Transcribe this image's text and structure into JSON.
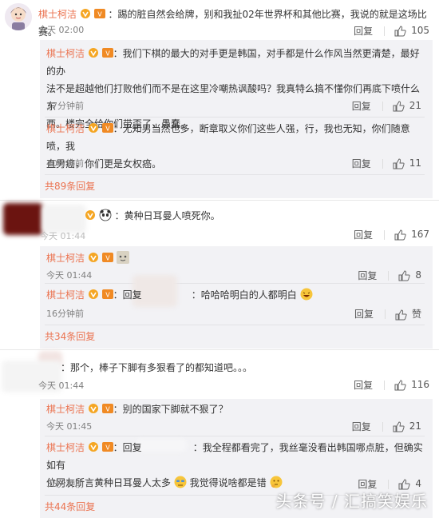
{
  "comments": [
    {
      "user": "棋士柯洁",
      "text": "：踢的脏自然会给牌，别和我扯02年世界杯和其他比赛，我说的就是这场比赛。",
      "time": "今天 02:00",
      "reply_label": "回复",
      "likes": "105",
      "replies": [
        {
          "user": "棋士柯洁",
          "text_1": "：我们下棋的最大的对手更是韩国，对手都是什么作风当然更清楚，最好的办",
          "text_2": "法不是超越他们打败他们而不是在这里冷嘲热讽酸吗？我真特么搞不懂你们再底下喷什么东",
          "text_3": "西。楼完全给你们带歪了，愚蠢。",
          "time": "37分钟前",
          "reply_label": "回复",
          "likes": "21"
        },
        {
          "user": "棋士柯洁",
          "text_1": "：无知男当然也多，断章取义你们这些人强，行，我也无知，你们随意喷，我",
          "text_2": "直男癌，你们更是女权癌。",
          "time": "40分钟前",
          "reply_label": "回复",
          "likes": "11"
        }
      ],
      "more": "共89条回复"
    },
    {
      "text": "：黄种日耳曼人喷死你。",
      "time": "今天 01:44",
      "reply_label": "回复",
      "likes": "167",
      "replies": [
        {
          "user": "棋士柯洁",
          "time": "今天 01:44",
          "reply_label": "回复",
          "likes": "8"
        },
        {
          "user": "棋士柯洁",
          "text_1": "：回复",
          "text_2": "：哈哈哈明白的人都明白",
          "time": "16分钟前",
          "reply_label": "回复",
          "likes": "赞"
        }
      ],
      "more": "共34条回复"
    },
    {
      "text": "：那个，棒子下脚有多狠看了的都知道吧。。。",
      "time": "今天 01:44",
      "reply_label": "回复",
      "likes": "116",
      "replies": [
        {
          "user": "棋士柯洁",
          "text_1": "：别的国家下脚就不狠了？",
          "time": "今天 01:45",
          "reply_label": "回复",
          "likes": "21"
        },
        {
          "user": "棋士柯洁",
          "text_1": "：回复",
          "text_2": "：我全程都看完了，我丝毫没看出韩国哪点脏，但确实如有",
          "text_3": "位网友所言黄种日耳曼人太多",
          "text_4": "我觉得说啥都是错",
          "time": "35分钟前",
          "reply_label": "回复",
          "likes": "4"
        }
      ],
      "more": "共44条回复"
    }
  ],
  "watermark": "头条号 / 汇搞笑娱乐",
  "colors": {
    "username": "#eb7350",
    "reply_bg": "#f2f2f5",
    "verified_badge": "#f5a623",
    "level_badge": "#f08a24"
  }
}
